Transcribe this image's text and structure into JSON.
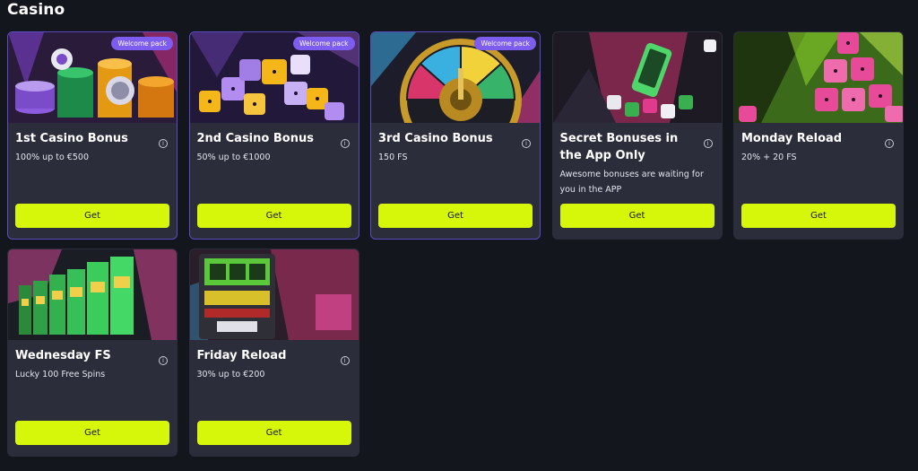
{
  "section": {
    "title": "Casino"
  },
  "colors": {
    "accent_button": "#d7f70a",
    "badge": "#7d5cf0",
    "card_bg": "#2b2d3a",
    "page_bg": "#13161d"
  },
  "cards": [
    {
      "title": "1st Casino Bonus",
      "description": "100% up to €500",
      "badge": "Welcome pack",
      "button": "Get",
      "art": "casino-chips-art"
    },
    {
      "title": "2nd Casino Bonus",
      "description": "50% up to €1000",
      "badge": "Welcome pack",
      "button": "Get",
      "art": "dice-art"
    },
    {
      "title": "3rd Casino Bonus",
      "description": "150 FS",
      "badge": "Welcome pack",
      "button": "Get",
      "art": "roulette-wheel-art"
    },
    {
      "title": "Secret Bonuses in the App Only",
      "description": "Awesome bonuses are waiting for you in the APP",
      "button": "Get",
      "art": "phone-dice-art"
    },
    {
      "title": "Monday Reload",
      "description": "20% + 20 FS",
      "button": "Get",
      "art": "pink-dice-art"
    },
    {
      "title": "Wednesday FS",
      "description": "Lucky 100 Free Spins",
      "button": "Get",
      "art": "slot-machines-row-art"
    },
    {
      "title": "Friday Reload",
      "description": "30% up to €200",
      "button": "Get",
      "art": "slot-machine-art"
    }
  ]
}
